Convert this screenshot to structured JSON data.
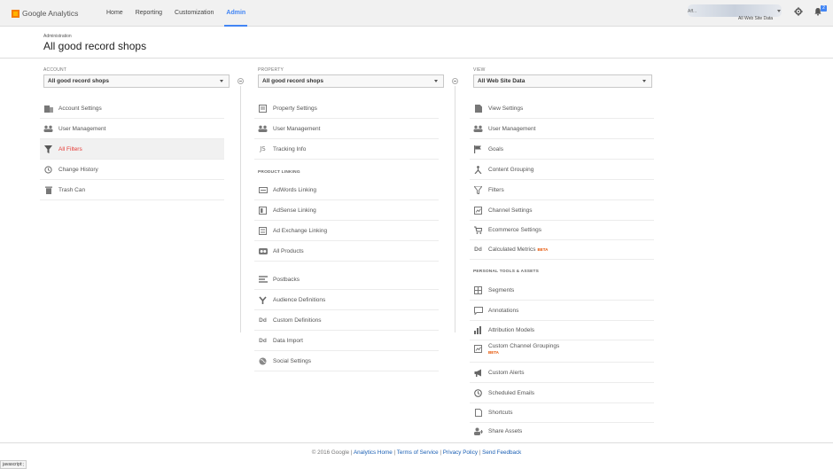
{
  "topbar": {
    "logo": "Google Analytics",
    "nav": [
      "Home",
      "Reporting",
      "Customization",
      "Admin"
    ],
    "active_nav": "Admin",
    "account_name": "Aff...",
    "account_sub": "All Web Site Data",
    "notification_count": "2"
  },
  "header": {
    "breadcrumb": "Administration",
    "title": "All good record shops"
  },
  "account": {
    "label": "ACCOUNT",
    "selected": "All good record shops",
    "items": [
      {
        "label": "Account Settings",
        "icon": "building-icon"
      },
      {
        "label": "User Management",
        "icon": "users-icon"
      },
      {
        "label": "All Filters",
        "icon": "filter-icon",
        "selected": true
      },
      {
        "label": "Change History",
        "icon": "history-icon"
      },
      {
        "label": "Trash Can",
        "icon": "trash-icon"
      }
    ]
  },
  "property": {
    "label": "PROPERTY",
    "selected": "All good record shops",
    "items": [
      {
        "label": "Property Settings",
        "icon": "property-icon"
      },
      {
        "label": "User Management",
        "icon": "users-icon"
      },
      {
        "label": "Tracking Info",
        "icon": "tracking-icon"
      }
    ],
    "section_label": "PRODUCT LINKING",
    "linking": [
      {
        "label": "AdWords Linking",
        "icon": "adwords-icon"
      },
      {
        "label": "AdSense Linking",
        "icon": "adsense-icon"
      },
      {
        "label": "Ad Exchange Linking",
        "icon": "adexchange-icon"
      },
      {
        "label": "All Products",
        "icon": "products-icon"
      }
    ],
    "other": [
      {
        "label": "Postbacks",
        "icon": "postbacks-icon"
      },
      {
        "label": "Audience Definitions",
        "icon": "audience-icon"
      },
      {
        "label": "Custom Definitions",
        "icon": "dd-icon"
      },
      {
        "label": "Data Import",
        "icon": "dd-icon"
      },
      {
        "label": "Social Settings",
        "icon": "globe-icon"
      }
    ]
  },
  "view": {
    "label": "VIEW",
    "selected": "All Web Site Data",
    "items": [
      {
        "label": "View Settings",
        "icon": "doc-icon"
      },
      {
        "label": "User Management",
        "icon": "users-icon"
      },
      {
        "label": "Goals",
        "icon": "flag-icon"
      },
      {
        "label": "Content Grouping",
        "icon": "grouping-icon"
      },
      {
        "label": "Filters",
        "icon": "filter-icon"
      },
      {
        "label": "Channel Settings",
        "icon": "channel-icon"
      },
      {
        "label": "Ecommerce Settings",
        "icon": "cart-icon"
      },
      {
        "label": "Calculated Metrics",
        "icon": "dd-icon",
        "badge": "BETA"
      }
    ],
    "section_label": "PERSONAL TOOLS & ASSETS",
    "personal": [
      {
        "label": "Segments",
        "icon": "segments-icon"
      },
      {
        "label": "Annotations",
        "icon": "annotations-icon"
      },
      {
        "label": "Attribution Models",
        "icon": "bar-chart-icon"
      },
      {
        "label": "Custom Channel Groupings",
        "icon": "channel-icon",
        "badge": "BETA"
      },
      {
        "label": "Custom Alerts",
        "icon": "megaphone-icon"
      },
      {
        "label": "Scheduled Emails",
        "icon": "clock-icon"
      },
      {
        "label": "Shortcuts",
        "icon": "shortcut-icon"
      },
      {
        "label": "Share Assets",
        "icon": "share-icon"
      }
    ]
  },
  "footer": {
    "copyright": "© 2016 Google",
    "links": [
      "Analytics Home",
      "Terms of Service",
      "Privacy Policy",
      "Send Feedback"
    ]
  },
  "status_bar": "javascript:;"
}
